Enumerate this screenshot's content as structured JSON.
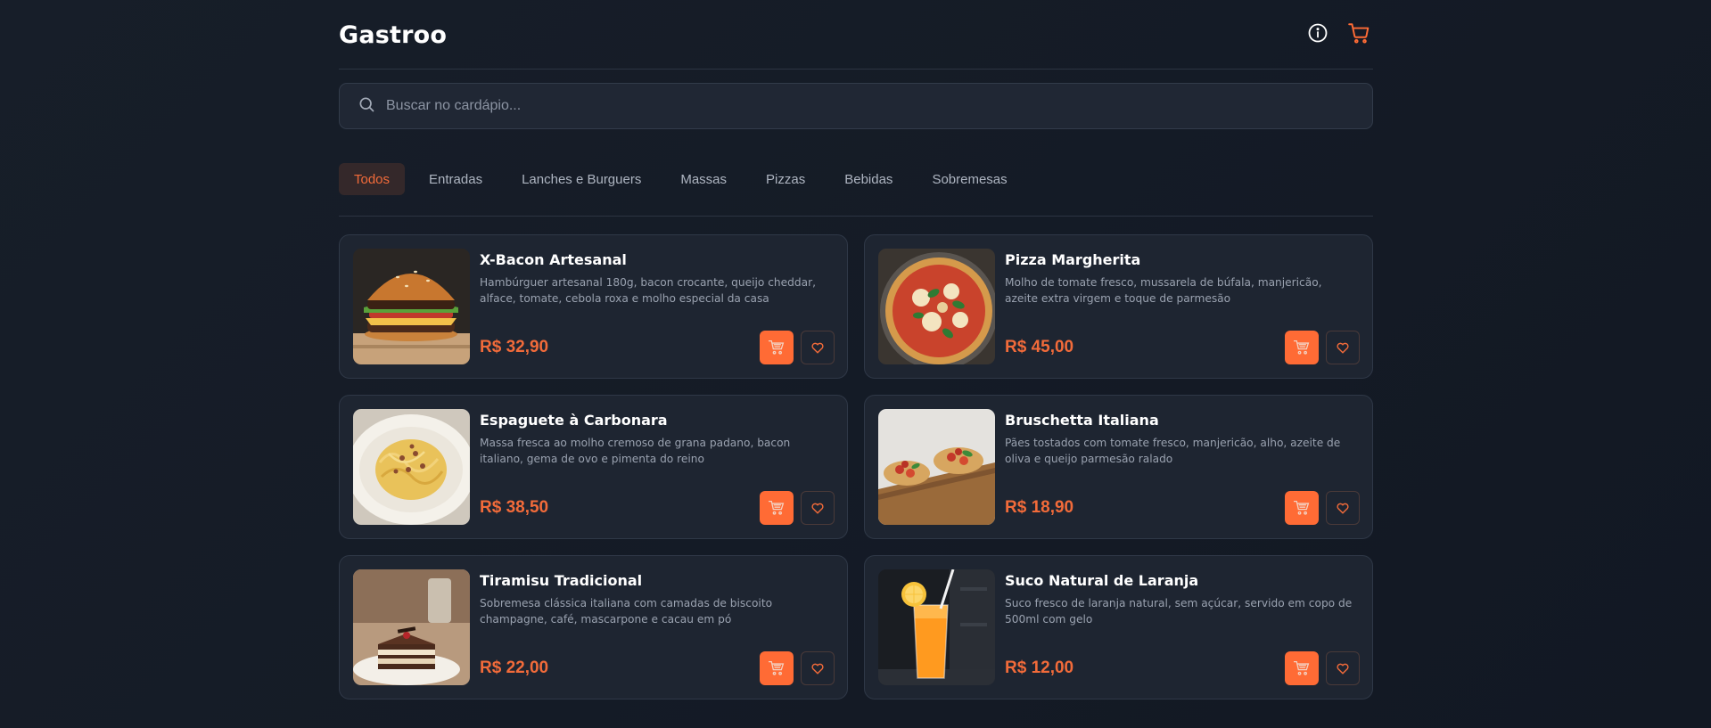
{
  "header": {
    "logo": "Gastroo",
    "info_icon": "info-icon",
    "cart_icon": "cart-icon"
  },
  "search": {
    "placeholder": "Buscar no cardápio...",
    "value": "",
    "icon": "search-icon"
  },
  "tabs": [
    {
      "label": "Todos",
      "active": true
    },
    {
      "label": "Entradas",
      "active": false
    },
    {
      "label": "Lanches e Burguers",
      "active": false
    },
    {
      "label": "Massas",
      "active": false
    },
    {
      "label": "Pizzas",
      "active": false
    },
    {
      "label": "Bebidas",
      "active": false
    },
    {
      "label": "Sobremesas",
      "active": false
    }
  ],
  "items": [
    {
      "name": "X-Bacon Artesanal",
      "description": "Hambúrguer artesanal 180g, bacon crocante, queijo cheddar, alface, tomate, cebola roxa e molho especial da casa",
      "price": "R$ 32,90",
      "image": "burger-photo"
    },
    {
      "name": "Pizza Margherita",
      "description": "Molho de tomate fresco, mussarela de búfala, manjericão, azeite extra virgem e toque de parmesão",
      "price": "R$ 45,00",
      "image": "pizza-photo"
    },
    {
      "name": "Espaguete à Carbonara",
      "description": "Massa fresca ao molho cremoso de grana padano, bacon italiano, gema de ovo e pimenta do reino",
      "price": "R$ 38,50",
      "image": "pasta-photo"
    },
    {
      "name": "Bruschetta Italiana",
      "description": "Pães tostados com tomate fresco, manjericão, alho, azeite de oliva e queijo parmesão ralado",
      "price": "R$ 18,90",
      "image": "bruschetta-photo"
    },
    {
      "name": "Tiramisu Tradicional",
      "description": "Sobremesa clássica italiana com camadas de biscoito champagne, café, mascarpone e cacau em pó",
      "price": "R$ 22,00",
      "image": "tiramisu-photo"
    },
    {
      "name": "Suco Natural de Laranja",
      "description": "Suco fresco de laranja natural, sem açúcar, servido em copo de 500ml com gelo",
      "price": "R$ 12,00",
      "image": "orange-juice-photo"
    }
  ],
  "colors": {
    "accent": "#ff6b35",
    "background": "#151b26",
    "card": "#1e2531"
  }
}
